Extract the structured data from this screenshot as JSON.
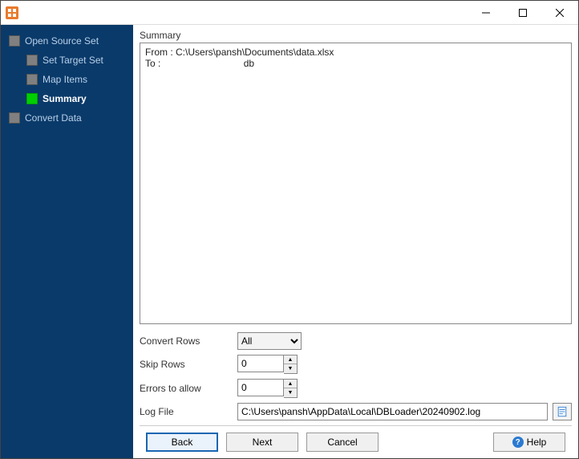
{
  "sidebar": {
    "items": [
      {
        "label": "Open Source Set",
        "active": false
      },
      {
        "label": "Set Target Set",
        "active": false
      },
      {
        "label": "Map Items",
        "active": false
      },
      {
        "label": "Summary",
        "active": true
      },
      {
        "label": "Convert Data",
        "active": false
      }
    ]
  },
  "main": {
    "section_label": "Summary",
    "summary": {
      "from_label": "From :",
      "from_value": "C:\\Users\\pansh\\Documents\\data.xlsx",
      "to_label": "To :",
      "to_value": "db"
    },
    "opts": {
      "convert_rows_label": "Convert Rows",
      "convert_rows_value": "All",
      "skip_rows_label": "Skip Rows",
      "skip_rows_value": "0",
      "errors_label": "Errors to allow",
      "errors_value": "0",
      "log_label": "Log File",
      "log_value": "C:\\Users\\pansh\\AppData\\Local\\DBLoader\\20240902.log"
    }
  },
  "footer": {
    "back": "Back",
    "next": "Next",
    "cancel": "Cancel",
    "help": "Help"
  }
}
